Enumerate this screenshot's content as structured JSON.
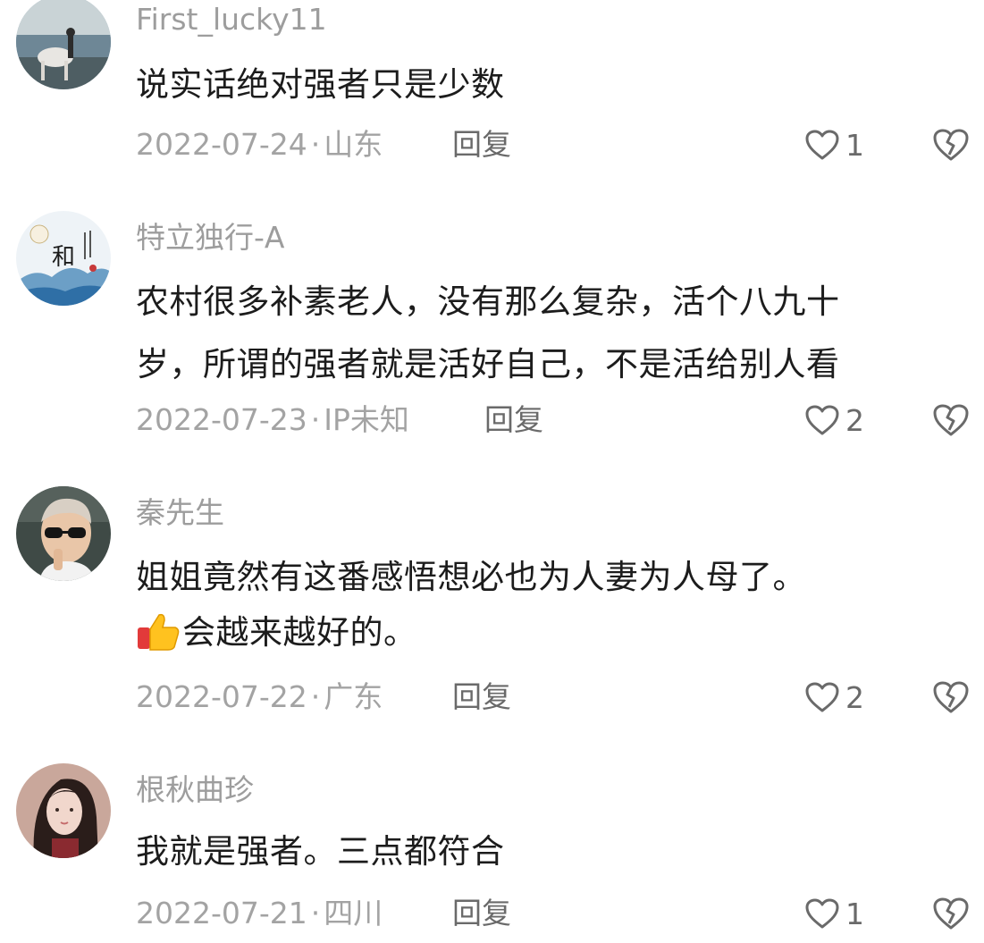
{
  "comments": [
    {
      "username": "First_lucky11",
      "lines": [
        "说实话绝对强者只是少数"
      ],
      "date": "2022-07-24",
      "location": "山东",
      "reply_label": "回复",
      "likes": "1"
    },
    {
      "username": "特立独行-A",
      "lines": [
        "农村很多补素老人，没有那么复杂，活个八九十",
        "岁，所谓的强者就是活好自己，不是活给别人看"
      ],
      "date": "2022-07-23",
      "location": "IP未知",
      "reply_label": "回复",
      "likes": "2"
    },
    {
      "username": "秦先生",
      "lines": [
        "姐姐竟然有这番感悟想必也为人妻为人母了。",
        "会越来越好的。"
      ],
      "date": "2022-07-22",
      "location": "广东",
      "reply_label": "回复",
      "likes": "2"
    },
    {
      "username": "根秋曲珍",
      "lines": [
        "我就是强者。三点都符合"
      ],
      "date": "2022-07-21",
      "location": "四川",
      "reply_label": "回复",
      "likes": "1"
    }
  ],
  "separator": "·",
  "icons": {
    "like": "heart-outline-icon",
    "dislike": "broken-heart-icon",
    "emoji": "thumbs-up-emoji"
  },
  "colors": {
    "username": "#9d9d9d",
    "meta": "#a3a3a3",
    "action": "#6a6a6a",
    "text": "#1c1c1c"
  }
}
